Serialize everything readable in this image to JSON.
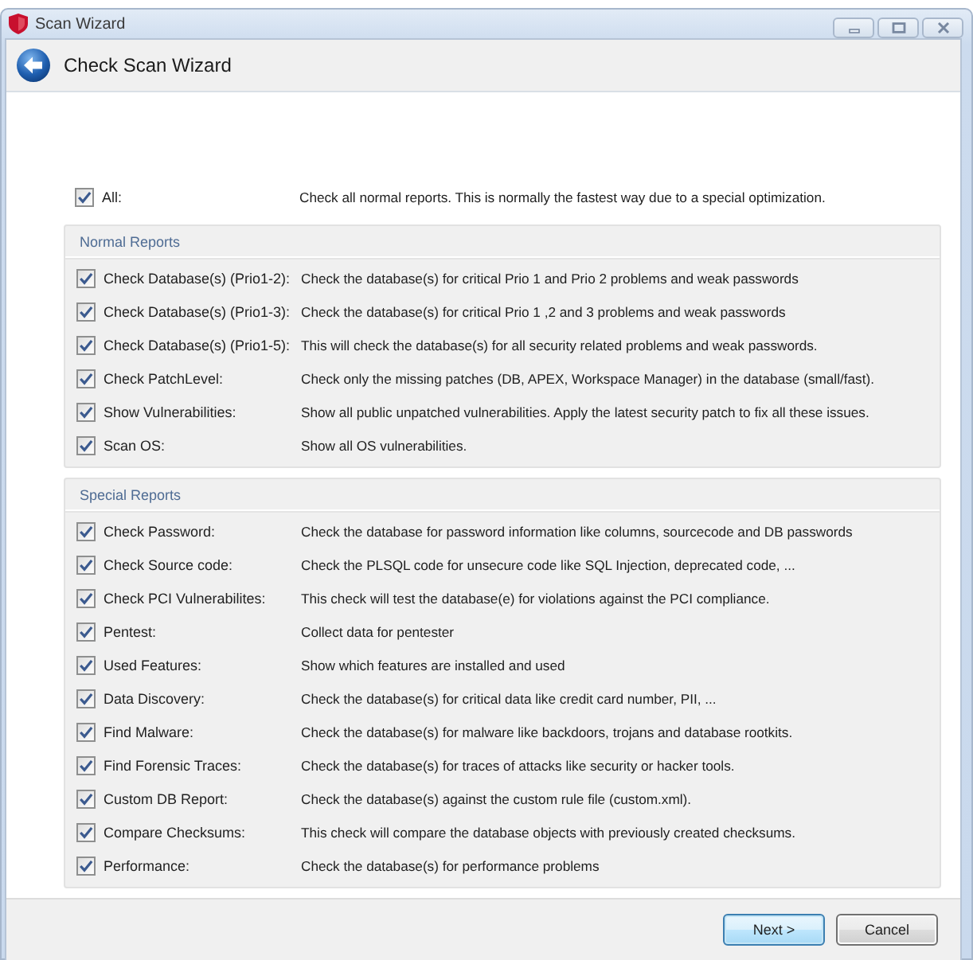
{
  "window": {
    "title": "Scan Wizard"
  },
  "header": {
    "title": "Check Scan Wizard"
  },
  "all_option": {
    "label": "All:",
    "description": "Check all normal reports. This is normally the fastest way due to a special optimization.",
    "checked": true
  },
  "groups": [
    {
      "title": "Normal Reports",
      "options": [
        {
          "label": "Check Database(s) (Prio1-2):",
          "description": "Check the database(s) for critical Prio 1 and Prio 2 problems and weak passwords",
          "checked": true
        },
        {
          "label": "Check Database(s) (Prio1-3):",
          "description": "Check the database(s) for critical Prio 1 ,2 and 3 problems and weak passwords",
          "checked": true
        },
        {
          "label": "Check Database(s) (Prio1-5):",
          "description": "This will check the database(s) for all security related problems and weak passwords.",
          "checked": true
        },
        {
          "label": "Check PatchLevel:",
          "description": "Check only the missing patches (DB, APEX, Workspace Manager) in the database (small/fast).",
          "checked": true
        },
        {
          "label": "Show Vulnerabilities:",
          "description": "Show all public unpatched vulnerabilities. Apply the latest security patch to fix all these issues.",
          "checked": true
        },
        {
          "label": "Scan OS:",
          "description": "Show all OS vulnerabilities.",
          "checked": true
        }
      ]
    },
    {
      "title": "Special Reports",
      "options": [
        {
          "label": "Check Password:",
          "description": "Check the database for password information like columns, sourcecode and DB passwords",
          "checked": true
        },
        {
          "label": "Check Source code:",
          "description": "Check the PLSQL code for unsecure code like SQL Injection, deprecated code, ...",
          "checked": true
        },
        {
          "label": "Check PCI Vulnerabilites:",
          "description": "This check will test the database(e) for violations against the PCI compliance.",
          "checked": true
        },
        {
          "label": "Pentest:",
          "description": "Collect data for pentester",
          "checked": true
        },
        {
          "label": "Used Features:",
          "description": "Show which features are installed and used",
          "checked": true
        },
        {
          "label": "Data Discovery:",
          "description": "Check the database(s) for critical data like credit card number, PII, ...",
          "checked": true
        },
        {
          "label": "Find Malware:",
          "description": "Check the database(s) for malware like backdoors, trojans and database rootkits.",
          "checked": true
        },
        {
          "label": "Find Forensic Traces:",
          "description": "Check the database(s) for traces of attacks like security or hacker tools.",
          "checked": true
        },
        {
          "label": "Custom DB Report:",
          "description": "Check the database(s) against the custom rule file (custom.xml).",
          "checked": true
        },
        {
          "label": "Compare Checksums:",
          "description": "This check will compare the database objects with previously created checksums.",
          "checked": true
        },
        {
          "label": "Performance:",
          "description": "Check the database(s) for performance problems",
          "checked": true
        }
      ]
    }
  ],
  "buttons": [
    {
      "label": "Next >",
      "default": true
    },
    {
      "label": "Cancel",
      "default": false
    }
  ]
}
